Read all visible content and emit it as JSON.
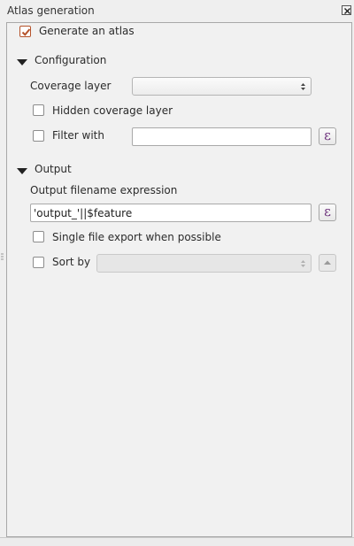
{
  "window": {
    "title": "Atlas generation"
  },
  "generate_atlas": {
    "label": "Generate an atlas",
    "checked": true
  },
  "configuration": {
    "title": "Configuration",
    "coverage_layer": {
      "label": "Coverage layer",
      "value": ""
    },
    "hidden_coverage": {
      "label": "Hidden coverage layer",
      "checked": false
    },
    "filter_with": {
      "label": "Filter with",
      "checked": false,
      "value": ""
    },
    "expression_icon": "epsilon-icon",
    "expression_symbol": "ε"
  },
  "output": {
    "title": "Output",
    "filename_label": "Output filename expression",
    "filename_value": "'output_'||$feature",
    "expression_symbol": "ε",
    "single_file": {
      "label": "Single file export when possible",
      "checked": false
    },
    "sort_by": {
      "label": "Sort by",
      "checked": false,
      "value": ""
    }
  },
  "colors": {
    "accent": "#b5532b",
    "expression": "#6b2f7a"
  }
}
